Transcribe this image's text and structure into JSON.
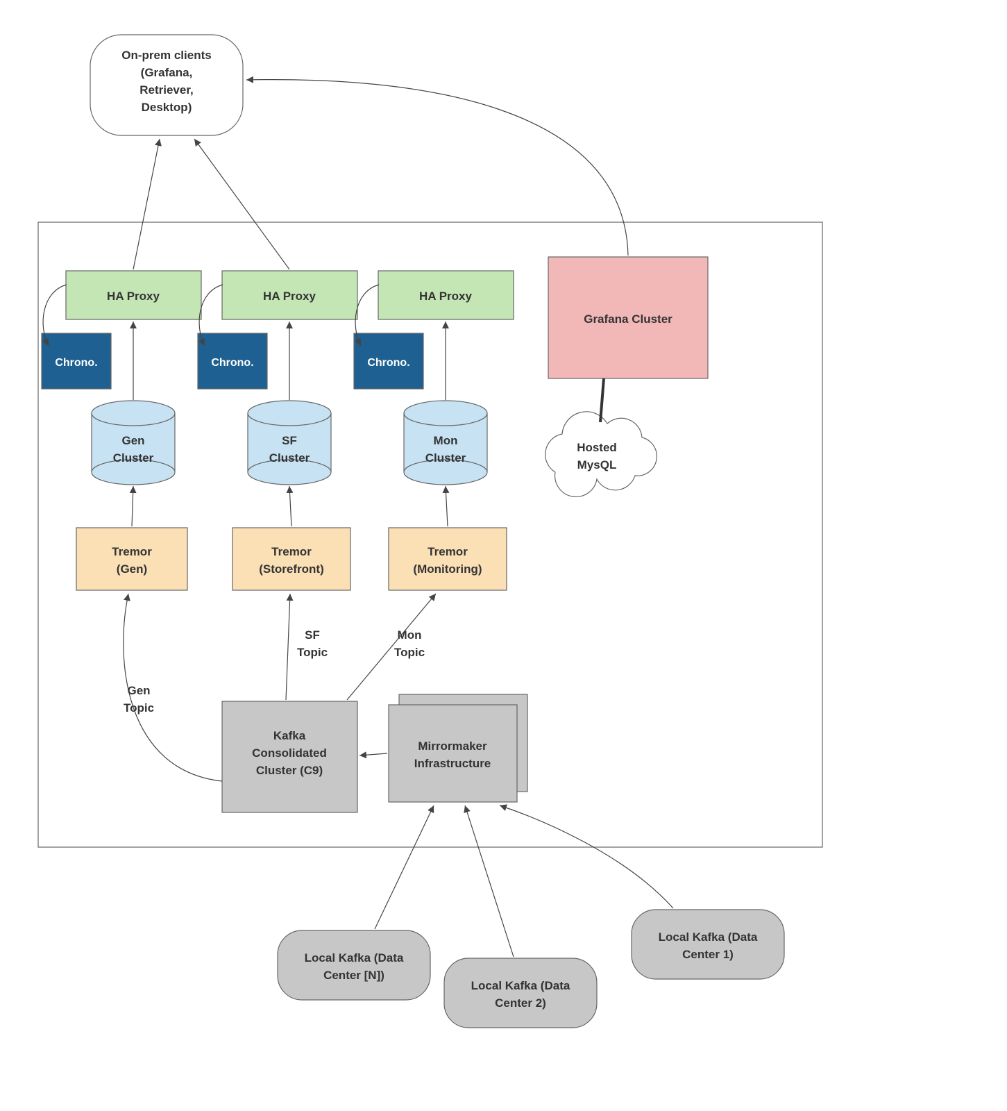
{
  "colors": {
    "green": "#c4e6b5",
    "blue": "#1e6091",
    "lightblue": "#c7e2f3",
    "orange": "#fbe0b5",
    "grey": "#c7c7c7",
    "pink": "#f2b7b7",
    "border": "#777777",
    "line": "#444444"
  },
  "onprem": {
    "line1": "On-prem clients",
    "line2": "(Grafana,",
    "line3": "Retriever,",
    "line4": "Desktop)"
  },
  "haproxy": {
    "a": "HA Proxy",
    "b": "HA Proxy",
    "c": "HA Proxy"
  },
  "chrono": {
    "label": "Chrono."
  },
  "clusters": {
    "gen": {
      "line1": "Gen",
      "line2": "Cluster"
    },
    "sf": {
      "line1": "SF",
      "line2": "Cluster"
    },
    "mon": {
      "line1": "Mon",
      "line2": "Cluster"
    }
  },
  "tremor": {
    "gen": {
      "line1": "Tremor",
      "line2": "(Gen)"
    },
    "sf": {
      "line1": "Tremor",
      "line2": "(Storefront)"
    },
    "mon": {
      "line1": "Tremor",
      "line2": "(Monitoring)"
    }
  },
  "topics": {
    "gen": {
      "line1": "Gen",
      "line2": "Topic"
    },
    "sf": {
      "line1": "SF",
      "line2": "Topic"
    },
    "mon": {
      "line1": "Mon",
      "line2": "Topic"
    }
  },
  "kafka": {
    "line1": "Kafka",
    "line2": "Consolidated",
    "line3": "Cluster (C9)"
  },
  "mirrormaker": {
    "line1": "Mirrormaker",
    "line2": "Infrastructure"
  },
  "grafana": {
    "label": "Grafana Cluster"
  },
  "mysql": {
    "line1": "Hosted",
    "line2": "MysQL"
  },
  "localkafka": {
    "n": {
      "line1": "Local Kafka (Data",
      "line2": "Center [N])"
    },
    "c2": {
      "line1": "Local Kafka (Data",
      "line2": "Center 2)"
    },
    "c1": {
      "line1": "Local Kafka (Data",
      "line2": "Center 1)"
    }
  }
}
